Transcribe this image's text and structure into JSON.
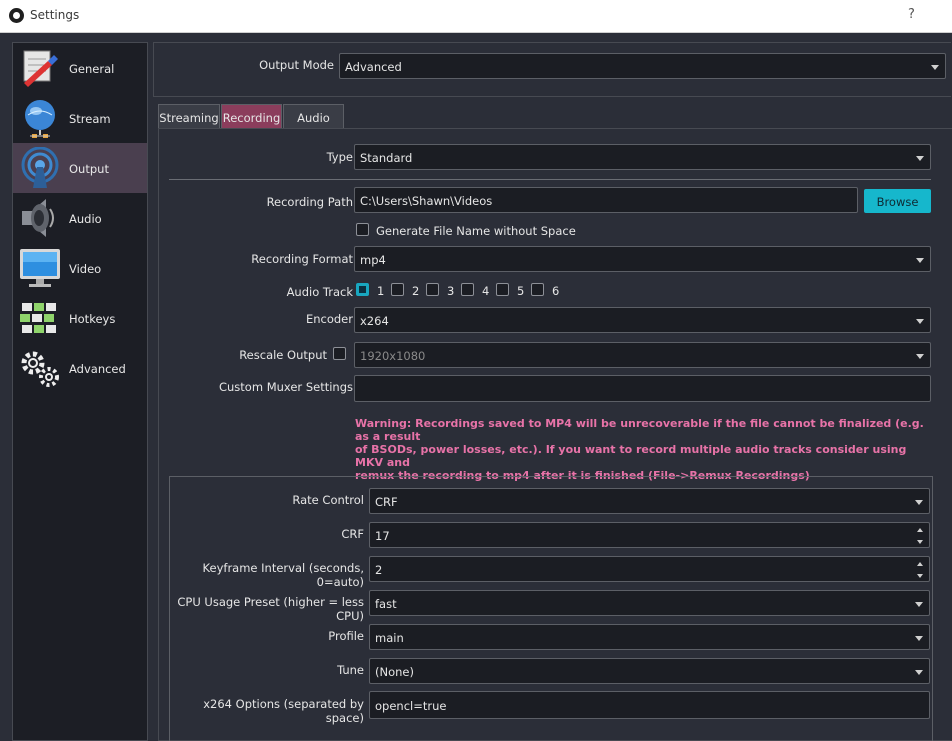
{
  "window": {
    "title": "Settings",
    "help": "?"
  },
  "sidebar": {
    "items": [
      {
        "label": "General",
        "icon": "general-icon"
      },
      {
        "label": "Stream",
        "icon": "stream-icon"
      },
      {
        "label": "Output",
        "icon": "output-icon",
        "active": true
      },
      {
        "label": "Audio",
        "icon": "audio-icon"
      },
      {
        "label": "Video",
        "icon": "video-icon"
      },
      {
        "label": "Hotkeys",
        "icon": "hotkeys-icon"
      },
      {
        "label": "Advanced",
        "icon": "advanced-icon"
      }
    ]
  },
  "output_mode": {
    "label": "Output Mode",
    "value": "Advanced"
  },
  "tabs": [
    {
      "label": "Streaming"
    },
    {
      "label": "Recording",
      "active": true
    },
    {
      "label": "Audio"
    }
  ],
  "recording": {
    "type": {
      "label": "Type",
      "value": "Standard"
    },
    "path": {
      "label": "Recording Path",
      "value": "C:\\Users\\Shawn\\Videos",
      "browse": "Browse"
    },
    "no_space": {
      "label": "Generate File Name without Space",
      "checked": false
    },
    "format": {
      "label": "Recording Format",
      "value": "mp4"
    },
    "audio_track": {
      "label": "Audio Track",
      "tracks": [
        {
          "n": "1",
          "checked": true
        },
        {
          "n": "2",
          "checked": false
        },
        {
          "n": "3",
          "checked": false
        },
        {
          "n": "4",
          "checked": false
        },
        {
          "n": "5",
          "checked": false
        },
        {
          "n": "6",
          "checked": false
        }
      ]
    },
    "encoder": {
      "label": "Encoder",
      "value": "x264"
    },
    "rescale": {
      "label": "Rescale Output",
      "checked": false,
      "value": "1920x1080"
    },
    "muxer": {
      "label": "Custom Muxer Settings",
      "value": ""
    },
    "warning_lines": [
      "Warning: Recordings saved to MP4 will be unrecoverable if the file cannot be finalized (e.g. as a result",
      "of BSODs, power losses, etc.). If you want to record multiple audio tracks consider using MKV and",
      "remux the recording to mp4 after it is finished (File->Remux Recordings)"
    ]
  },
  "encoder_settings": {
    "rate_control": {
      "label": "Rate Control",
      "value": "CRF"
    },
    "crf": {
      "label": "CRF",
      "value": "17"
    },
    "keyframe": {
      "label": "Keyframe Interval (seconds, 0=auto)",
      "value": "2"
    },
    "cpu_preset": {
      "label": "CPU Usage Preset (higher = less CPU)",
      "value": "fast"
    },
    "profile": {
      "label": "Profile",
      "value": "main"
    },
    "tune": {
      "label": "Tune",
      "value": "(None)"
    },
    "x264_options": {
      "label": "x264 Options (separated by space)",
      "value": "opencl=true"
    }
  },
  "colors": {
    "accent": "#16b7cc",
    "active_tab": "#8b3d5c",
    "warning": "#e873a8",
    "active_sidebar": "#4a3f4f"
  }
}
